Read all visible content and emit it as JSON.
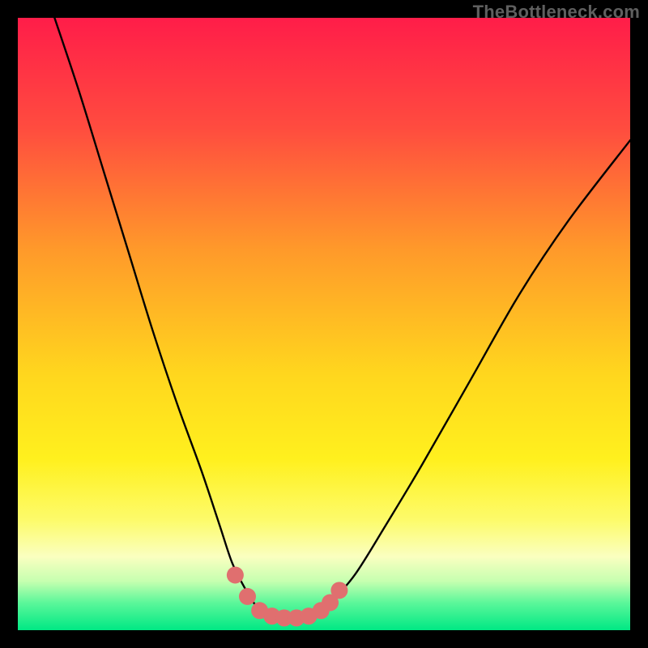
{
  "watermark": "TheBottleneck.com",
  "chart_data": {
    "type": "line",
    "title": "",
    "xlabel": "",
    "ylabel": "",
    "xlim": [
      0,
      100
    ],
    "ylim": [
      0,
      100
    ],
    "series": [
      {
        "name": "bottleneck-curve",
        "x": [
          6,
          10,
          14,
          18,
          22,
          26,
          30,
          33,
          35,
          37,
          38.5,
          40,
          41.5,
          43,
          45,
          47,
          49,
          51,
          55,
          60,
          66,
          74,
          82,
          90,
          100
        ],
        "y": [
          100,
          88,
          75,
          62,
          49,
          37,
          26,
          17,
          11,
          7,
          4.5,
          3,
          2.2,
          2,
          2,
          2.2,
          3,
          4.5,
          9,
          17,
          27,
          41,
          55,
          67,
          80
        ]
      }
    ],
    "markers": {
      "name": "optimal-range-dots",
      "x": [
        35.5,
        37.5,
        39.5,
        41.5,
        43.5,
        45.5,
        47.5,
        49.5,
        51,
        52.5
      ],
      "y": [
        9,
        5.5,
        3.2,
        2.3,
        2,
        2,
        2.3,
        3.2,
        4.5,
        6.5
      ]
    },
    "background": {
      "type": "vertical-gradient",
      "stops": [
        {
          "pos": 0.0,
          "color": "#ff1d49"
        },
        {
          "pos": 0.18,
          "color": "#ff4c3f"
        },
        {
          "pos": 0.38,
          "color": "#ff9a2a"
        },
        {
          "pos": 0.58,
          "color": "#ffd61e"
        },
        {
          "pos": 0.72,
          "color": "#fff01e"
        },
        {
          "pos": 0.82,
          "color": "#fdfb6a"
        },
        {
          "pos": 0.88,
          "color": "#faffc0"
        },
        {
          "pos": 0.92,
          "color": "#c6ffb0"
        },
        {
          "pos": 0.955,
          "color": "#5cf79a"
        },
        {
          "pos": 1.0,
          "color": "#00e884"
        }
      ]
    },
    "curve_color": "#000000",
    "marker_color": "#e06f6f"
  }
}
